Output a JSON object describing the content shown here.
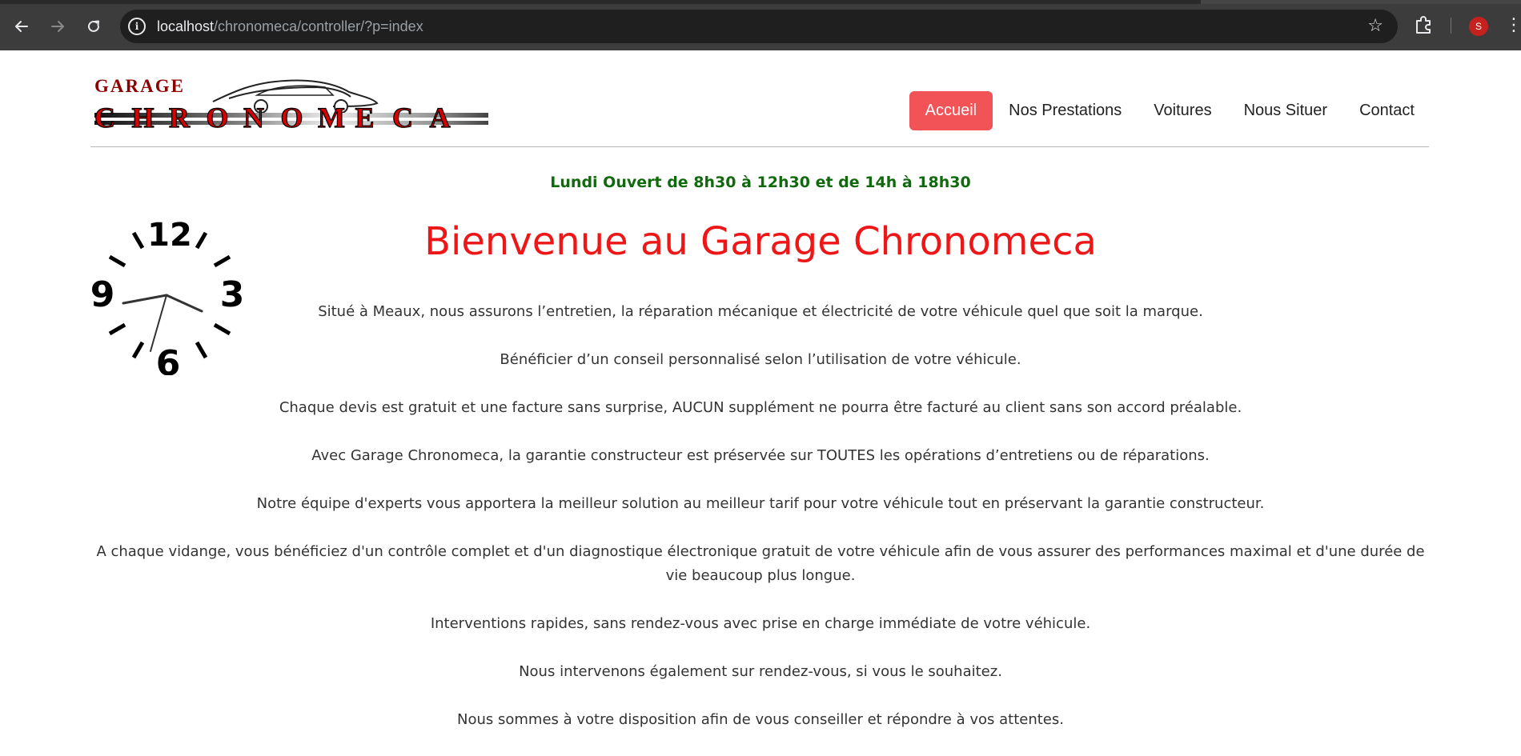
{
  "browser": {
    "url_host": "localhost",
    "url_path": "/chronomeca/controller/?p=index",
    "profile_initial": "S",
    "icons": {
      "back": "arrow-left-icon",
      "forward": "arrow-right-icon",
      "reload": "reload-icon",
      "site_info": "info-icon",
      "bookmark": "star-icon",
      "extensions": "puzzle-icon",
      "menu": "kebab-menu-icon"
    }
  },
  "header": {
    "logo_top": "GARAGE",
    "logo_letters": [
      "C",
      "H",
      "R",
      "O",
      "N",
      "O",
      "M",
      "E",
      "C",
      "A"
    ],
    "nav": [
      {
        "label": "Accueil",
        "active": true
      },
      {
        "label": "Nos Prestations",
        "active": false
      },
      {
        "label": "Voitures",
        "active": false
      },
      {
        "label": "Nous Situer",
        "active": false
      },
      {
        "label": "Contact",
        "active": false
      }
    ]
  },
  "hours": "Lundi Ouvert de 8h30 à 12h30 et de 14h à 18h30",
  "clock": {
    "numerals": [
      "12",
      "3",
      "6",
      "9"
    ]
  },
  "main": {
    "title": "Bienvenue au Garage Chronomeca",
    "paragraphs": [
      "Situé à Meaux, nous assurons l’entretien, la réparation mécanique et électricité de votre véhicule quel que soit la marque.",
      "Bénéficier d’un conseil personnalisé selon l’utilisation de votre véhicule.",
      "Chaque devis est gratuit et une facture sans surprise, AUCUN supplément ne pourra être facturé au client sans son accord préalable.",
      "Avec Garage Chronomeca, la garantie constructeur est préservée sur TOUTES les opérations d’entretiens ou de réparations.",
      "Notre équipe d'experts vous apportera la meilleur solution au meilleur tarif pour votre véhicule tout en préservant la garantie constructeur.",
      "A chaque vidange, vous bénéficiez d'un contrôle complet et d'un diagnostique électronique gratuit de votre véhicule afin de vous assurer des performances maximal et d'une durée de vie beaucoup plus longue.",
      "Interventions rapides, sans rendez-vous avec prise en charge immédiate de votre véhicule.",
      "Nous intervenons également sur rendez-vous, si vous le souhaitez.",
      "Nous sommes à votre disposition afin de vous conseiller et répondre à vos attentes."
    ]
  },
  "colors": {
    "accent": "#f15357",
    "title": "#ee1616",
    "hours": "#11690e",
    "logo_red": "#d60000"
  }
}
